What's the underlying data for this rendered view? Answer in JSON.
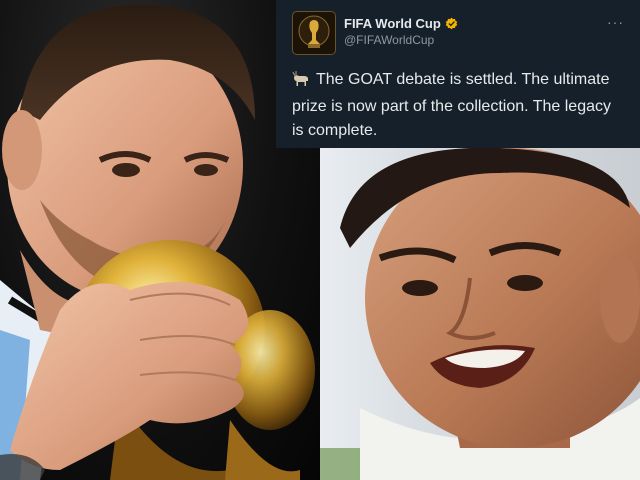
{
  "tweet": {
    "display_name": "FIFA World Cup",
    "handle": "@FIFAWorldCup",
    "text": "The GOAT debate is settled. The ultimate prize is now part of the collection. The legacy is complete.",
    "more_label": "···",
    "emoji_icon": "goat-icon",
    "verified_icon": "verified-icon",
    "avatar_icon": "world-cup-trophy-icon"
  },
  "colors": {
    "tweet_background": "#15202b",
    "text": "#e7e9ea",
    "handle": "#8b98a5",
    "verified": "#f4b400"
  }
}
